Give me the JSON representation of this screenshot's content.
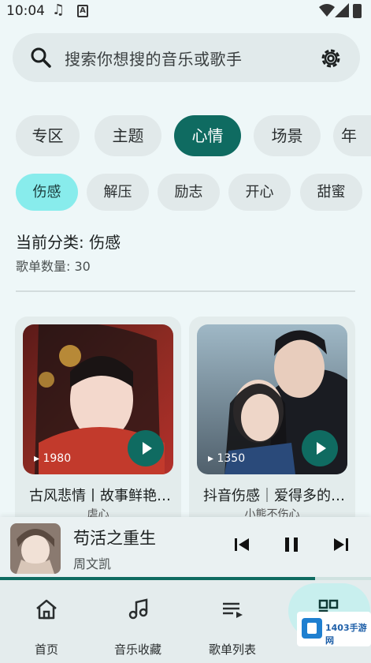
{
  "status_bar": {
    "time": "10:04",
    "music_icon": "music-note-icon",
    "a_icon": "A"
  },
  "search": {
    "placeholder": "搜索你想搜的音乐或歌手"
  },
  "categories": [
    "专区",
    "主题",
    "心情",
    "场景",
    "年"
  ],
  "categories_active": "心情",
  "moods": [
    "伤感",
    "解压",
    "励志",
    "开心",
    "甜蜜"
  ],
  "moods_active": "伤感",
  "current_category": "当前分类: 伤感",
  "playlist_count": "歌单数量: 30",
  "playlists": [
    {
      "title": "古风悲情丨故事鲜艳凄美的古风说唱",
      "creator": "虐心",
      "play_count": "1980"
    },
    {
      "title": "抖音伤感｜爱得多的人总是会受伤",
      "creator": "小熊不伤心",
      "play_count": "1350"
    }
  ],
  "now_playing": {
    "title": "苟活之重生",
    "artist": "周文凯",
    "progress_fraction": 0.85
  },
  "nav": [
    {
      "label": "首页",
      "icon": "home-icon"
    },
    {
      "label": "音乐收藏",
      "icon": "music-note-icon"
    },
    {
      "label": "歌单列表",
      "icon": "playlist-icon"
    },
    {
      "label": "",
      "icon": "qr-code-icon"
    }
  ],
  "watermark": {
    "text": "1403手游网"
  },
  "colors": {
    "accent": "#0f6b61",
    "accent_light": "#88ecec",
    "background": "#eef7f8"
  }
}
